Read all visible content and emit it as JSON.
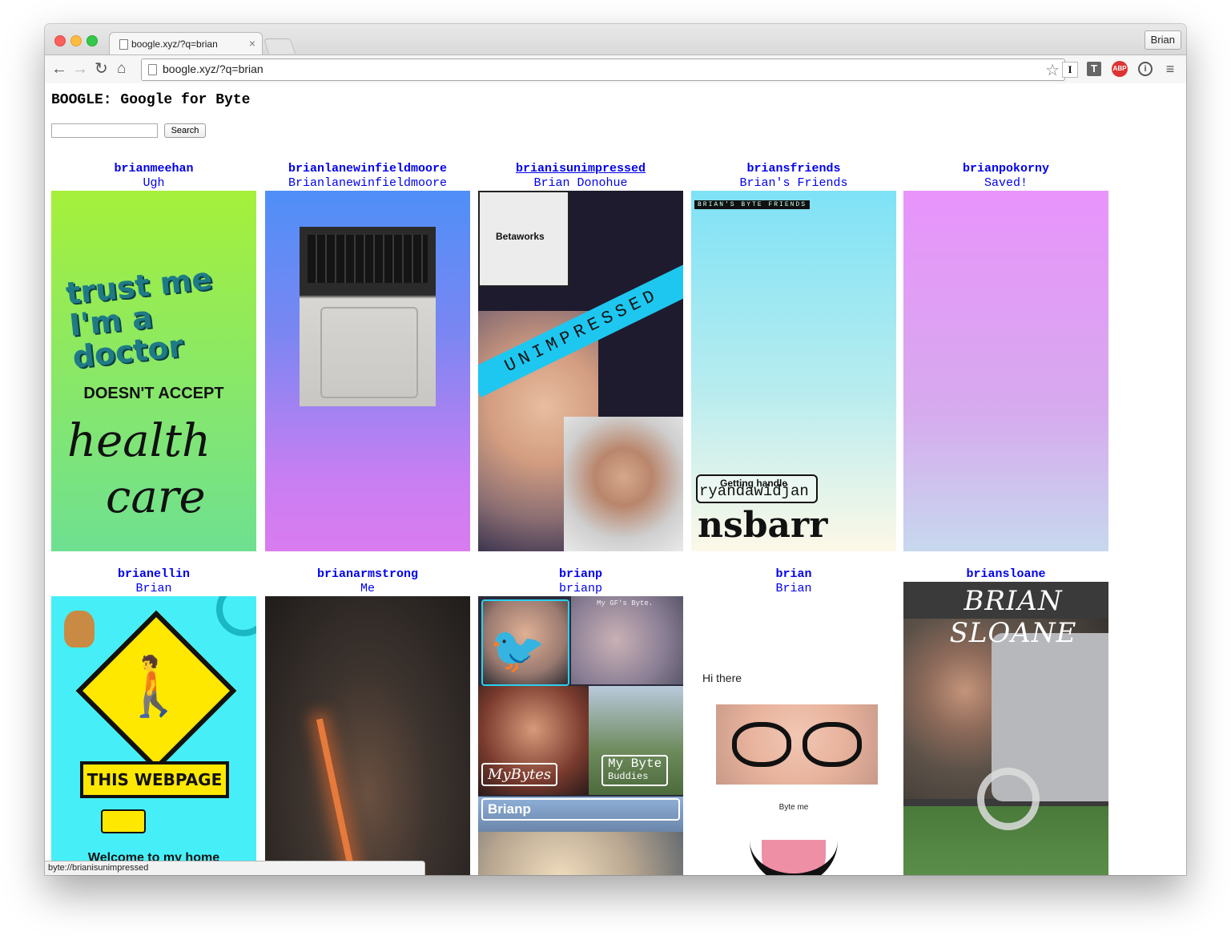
{
  "browser": {
    "tab_title": "boogle.xyz/?q=brian",
    "tab_close": "×",
    "profile_name": "Brian",
    "address_text": "boogle.xyz/?q=brian",
    "ext_i": "I",
    "ext_t": "T",
    "ext_abp": "ABP",
    "ext_info": "i",
    "menu": "≡",
    "back": "←",
    "forward": "→",
    "reload": "↻",
    "home": "⌂",
    "star": "☆"
  },
  "page": {
    "title": "BOOGLE: Google for Byte",
    "search_value": "",
    "search_button": "Search"
  },
  "results": [
    {
      "username": "brianmeehan",
      "name": "Ugh",
      "thumb_text": [
        "trust me",
        "I'm a doctor",
        "DOESN'T ACCEPT",
        "health",
        "care"
      ]
    },
    {
      "username": "brianlanewinfieldmoore",
      "name": "Brianlanewinfieldmoore"
    },
    {
      "username": "brianisunimpressed",
      "name": "Brian Donohue",
      "thumb_text": [
        "Betaworks",
        "UNIMPRESSED"
      ]
    },
    {
      "username": "briansfriends",
      "name": "Brian's Friends",
      "thumb_text": [
        "BRIAN'S BYTE FRIENDS",
        "Getting handle",
        "ryandawidjan",
        "nsbarr"
      ]
    },
    {
      "username": "brianpokorny",
      "name": "Saved!"
    },
    {
      "username": "brianellin",
      "name": "Brian",
      "thumb_text": [
        "THIS WEBPAGE",
        "Welcome to my home"
      ]
    },
    {
      "username": "brianarmstrong",
      "name": "Me"
    },
    {
      "username": "brianp",
      "name": "brianp",
      "thumb_text": [
        "My GF's Byte.",
        "MyBytes",
        "My Byte",
        "Buddies",
        "Brianp"
      ]
    },
    {
      "username": "brian",
      "name": "Brian",
      "thumb_text": [
        "Hi there",
        "Byte me"
      ]
    },
    {
      "username": "briansloane",
      "name": "",
      "thumb_text": [
        "BRIAN SLOANE"
      ]
    }
  ],
  "status_bar": "byte://brianisunimpressed",
  "colors": {
    "link": "#0000ee"
  }
}
